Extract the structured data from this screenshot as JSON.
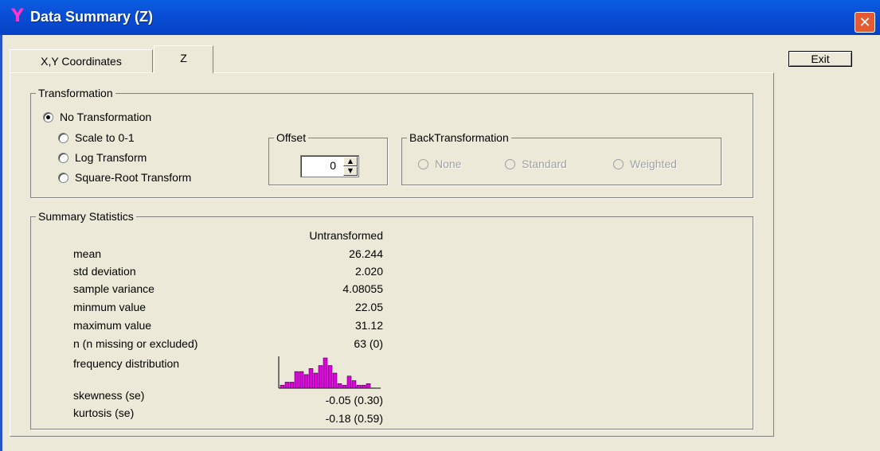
{
  "window": {
    "title": "Data Summary (Z)",
    "icon": "Y",
    "close_glyph": "✕"
  },
  "tabs": [
    {
      "label": "X,Y Coordinates"
    },
    {
      "label": "Z"
    }
  ],
  "exit_label": "Exit",
  "transformation": {
    "legend": "Transformation",
    "options": [
      {
        "label": "No Transformation",
        "selected": true
      },
      {
        "label": "Scale to 0-1",
        "selected": false
      },
      {
        "label": "Log Transform",
        "selected": false
      },
      {
        "label": "Square-Root Transform",
        "selected": false
      }
    ],
    "offset": {
      "legend": "Offset",
      "value": "0"
    },
    "back_transformation": {
      "legend": "BackTransformation",
      "options": [
        {
          "label": "None"
        },
        {
          "label": "Standard"
        },
        {
          "label": "Weighted"
        }
      ]
    }
  },
  "summary": {
    "legend": "Summary Statistics",
    "column_header": "Untransformed",
    "rows": [
      {
        "label": "mean",
        "value": "26.244"
      },
      {
        "label": "std deviation",
        "value": "2.020"
      },
      {
        "label": "sample variance",
        "value": "4.08055"
      },
      {
        "label": "minmum value",
        "value": "22.05"
      },
      {
        "label": "maximum value",
        "value": "31.12"
      },
      {
        "label": "n (n missing or excluded)",
        "value": "63 (0)"
      }
    ],
    "frequency_label": "frequency distribution",
    "histogram": {
      "bar_color": "#E000E0",
      "relative_heights": [
        0.1,
        0.2,
        0.2,
        0.55,
        0.55,
        0.45,
        0.65,
        0.5,
        0.75,
        1.0,
        0.75,
        0.5,
        0.15,
        0.1,
        0.4,
        0.25,
        0.1,
        0.1,
        0.15
      ]
    },
    "skewness_label": "skewness (se)",
    "skewness_value": "-0.05 (0.30)",
    "kurtosis_label": "kurtosis (se)",
    "kurtosis_value": "-0.18 (0.59)"
  }
}
